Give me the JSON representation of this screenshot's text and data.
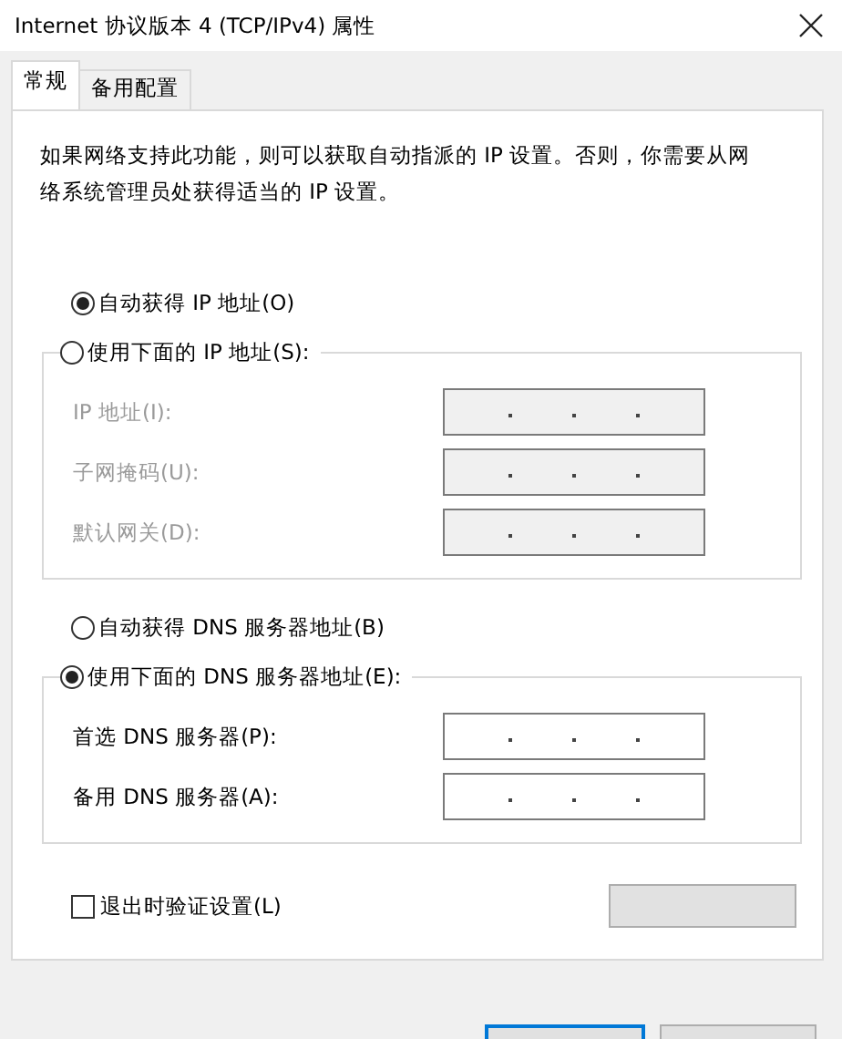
{
  "window": {
    "title": "Internet 协议版本 4 (TCP/IPv4) 属性"
  },
  "tabs": [
    {
      "label": "常规",
      "selected": true
    },
    {
      "label": "备用配置",
      "selected": false
    }
  ],
  "description": "如果网络支持此功能，则可以获取自动指派的 IP 设置。否则，你需要从网络系统管理员处获得适当的 IP 设置。",
  "ip": {
    "auto_option": {
      "label": "自动获得 IP 地址(O)",
      "selected": true
    },
    "manual_option": {
      "label": "使用下面的 IP 地址(S):",
      "selected": false
    },
    "disabled": true,
    "fields": [
      {
        "label": "IP 地址(I):"
      },
      {
        "label": "子网掩码(U):"
      },
      {
        "label": "默认网关(D):"
      }
    ]
  },
  "dns": {
    "auto_option": {
      "label": "自动获得 DNS 服务器地址(B)",
      "selected": false
    },
    "manual_option": {
      "label": "使用下面的 DNS 服务器地址(E):",
      "selected": true
    },
    "disabled": false,
    "fields": [
      {
        "label": "首选 DNS 服务器(P):"
      },
      {
        "label": "备用 DNS 服务器(A):"
      }
    ]
  },
  "validate_checkbox": {
    "label": "退出时验证设置(L)",
    "checked": false
  }
}
